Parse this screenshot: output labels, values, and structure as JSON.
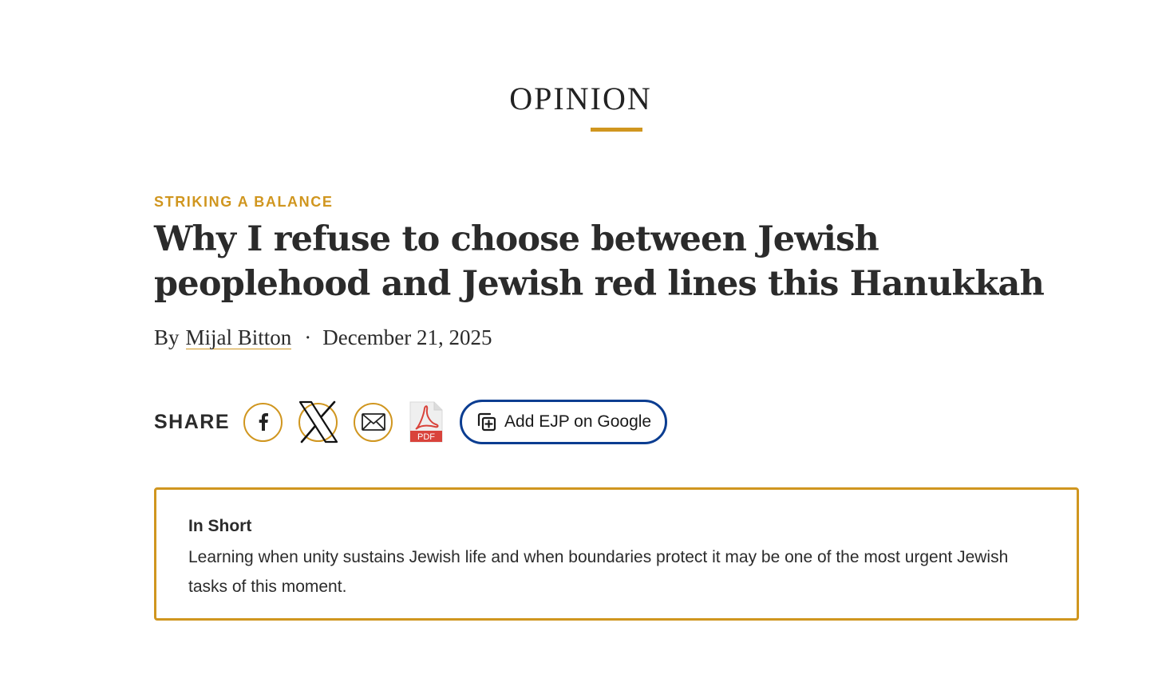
{
  "section": {
    "title": "OPINION"
  },
  "article": {
    "kicker": "STRIKING A BALANCE",
    "headline": "Why I refuse to choose between Jewish peoplehood and Jewish red lines this Hanukkah",
    "byline_prefix": "By",
    "author": "Mijal Bitton",
    "separator": "·",
    "date": "December 21, 2025"
  },
  "share": {
    "label": "SHARE",
    "icons": [
      "facebook-icon",
      "x-icon",
      "email-icon",
      "pdf-icon"
    ],
    "pdf_label": "PDF",
    "google_label": "Add EJP on Google"
  },
  "in_short": {
    "title": "In Short",
    "text": "Learning when unity sustains Jewish life and when boundaries protect it may be one of the most urgent Jewish tasks of this moment."
  },
  "colors": {
    "accent": "#d0961f",
    "google_border": "#0b3d91",
    "pdf_red": "#d9433b",
    "text": "#2b2b2b"
  }
}
